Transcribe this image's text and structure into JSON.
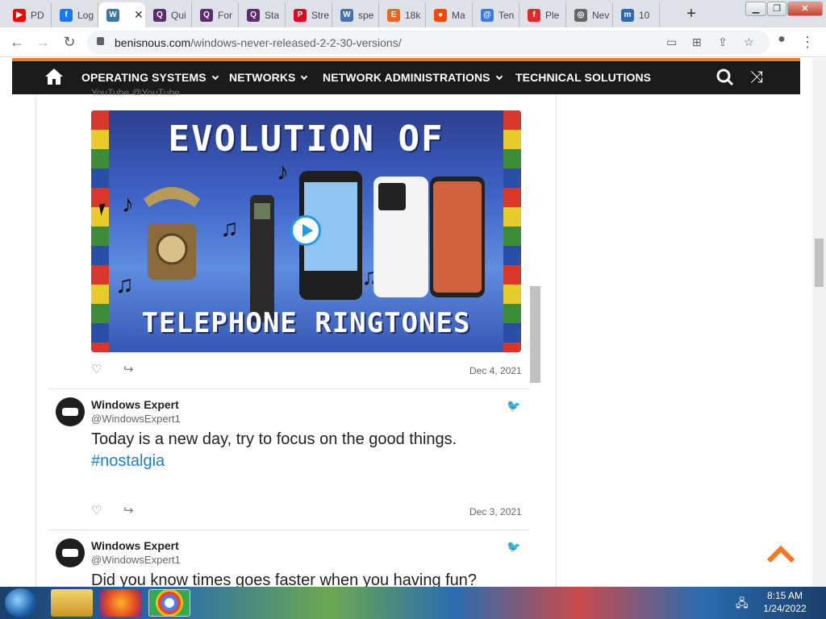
{
  "browser": {
    "tabs": [
      {
        "label": "PD",
        "favicon": "youtube-icon",
        "color": "#ff0000",
        "glyph": "▶"
      },
      {
        "label": "Log",
        "favicon": "facebook-icon",
        "color": "#1877f2",
        "glyph": "f"
      },
      {
        "label": "",
        "favicon": "wordpress-icon",
        "color": "#3c76a5",
        "glyph": "W",
        "active": true
      },
      {
        "label": "Qui",
        "favicon": "quora-icon",
        "color": "#5c2d6e",
        "glyph": "Q"
      },
      {
        "label": "For",
        "favicon": "quora-icon",
        "color": "#5c2d6e",
        "glyph": "Q"
      },
      {
        "label": "Sta",
        "favicon": "quora-icon",
        "color": "#5c2d6e",
        "glyph": "Q"
      },
      {
        "label": "Stre",
        "favicon": "pinterest-icon",
        "color": "#e60023",
        "glyph": "P"
      },
      {
        "label": "spe",
        "favicon": "wiktionary-icon",
        "color": "#4a6fb0",
        "glyph": "W"
      },
      {
        "label": "18k",
        "favicon": "etsy-icon",
        "color": "#f1641e",
        "glyph": "E"
      },
      {
        "label": "Ma",
        "favicon": "reddit-icon",
        "color": "#ff4500",
        "glyph": "●"
      },
      {
        "label": "Ten",
        "favicon": "at-icon",
        "color": "#3b78e7",
        "glyph": "@"
      },
      {
        "label": "Ple",
        "favicon": "flipboard-icon",
        "color": "#e12828",
        "glyph": "f"
      },
      {
        "label": "Nev",
        "favicon": "chrome-icon",
        "color": "#666666",
        "glyph": "◎"
      },
      {
        "label": "10",
        "favicon": "news-icon",
        "color": "#2b6cb0",
        "glyph": "m"
      }
    ],
    "new_tab": "+",
    "url_domain": "benisnous.com",
    "url_path": "/windows-never-released-2-2-30-versions/"
  },
  "site": {
    "nav": [
      "OPERATING SYSTEMS",
      "NETWORKS",
      "NETWORK ADMINISTRATIONS",
      "TECHNICAL SOLUTIONS"
    ],
    "nav_dropdown": [
      true,
      true,
      true,
      false
    ],
    "accent": "#f47820",
    "nav_bg": "#1a1a1a"
  },
  "video": {
    "title_top": "EVOLUTION OF",
    "title_bottom": "TELEPHONE RINGTONES",
    "top_partial": "YouTube @YouTube",
    "date": "Dec 4, 2021"
  },
  "tweets": [
    {
      "name": "Windows Expert",
      "handle": "@WindowsExpert1",
      "text": "Today is a new day, try to focus on the good things.",
      "hashtag": "#nostalgia",
      "date": "Dec 3, 2021"
    },
    {
      "name": "Windows Expert",
      "handle": "@WindowsExpert1",
      "text": "Did you know times goes faster when you having fun?"
    }
  ],
  "taskbar": {
    "time": "8:15 AM",
    "date": "1/24/2022"
  }
}
